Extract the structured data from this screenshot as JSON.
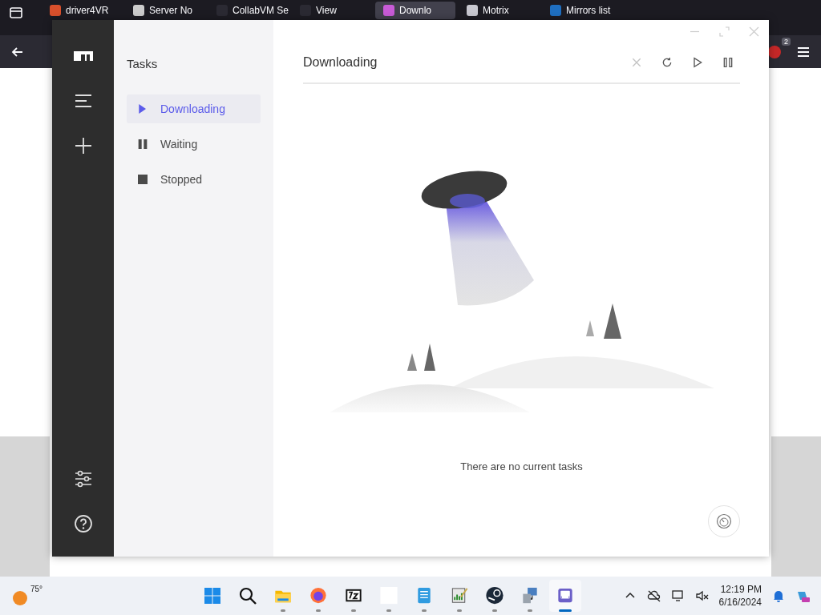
{
  "browser": {
    "tabs": [
      {
        "label": "driver4VR",
        "selected": false,
        "color": "#d9502c"
      },
      {
        "label": "Server No",
        "selected": false,
        "color": "#cccccc"
      },
      {
        "label": "CollabVM Se",
        "selected": false,
        "color": "#2b2a33"
      },
      {
        "label": "View",
        "selected": false,
        "color": "#2b2a33"
      },
      {
        "label": "Downlo",
        "selected": true,
        "color": "#c75bd6"
      },
      {
        "label": "Motrix",
        "selected": false,
        "color": "#c8c8d0"
      },
      {
        "label": "Mirrors list",
        "selected": false,
        "color": "#1f6fc0"
      }
    ],
    "badge": "2"
  },
  "app": {
    "task_list": {
      "title": "Tasks",
      "items": [
        {
          "label": "Downloading",
          "kind": "play",
          "selected": true
        },
        {
          "label": "Waiting",
          "kind": "pause",
          "selected": false
        },
        {
          "label": "Stopped",
          "kind": "stop",
          "selected": false
        }
      ]
    },
    "main": {
      "title": "Downloading",
      "toolbar": [
        {
          "kind": "delete",
          "disabled": true
        },
        {
          "kind": "refresh",
          "disabled": false
        },
        {
          "kind": "resume",
          "disabled": false
        },
        {
          "kind": "pause",
          "disabled": false
        }
      ],
      "empty_message": "There are no current tasks"
    }
  },
  "taskbar": {
    "weather": "75°",
    "apps": [
      {
        "kind": "explorer",
        "active": false
      },
      {
        "kind": "firefox",
        "active": false
      },
      {
        "kind": "archive",
        "active": false
      },
      {
        "kind": "blank",
        "active": false
      },
      {
        "kind": "notepad",
        "active": false
      },
      {
        "kind": "chart",
        "active": false
      },
      {
        "kind": "steam",
        "active": false
      },
      {
        "kind": "network",
        "active": false
      },
      {
        "kind": "motrix",
        "active": true
      }
    ],
    "time": "12:19 PM",
    "date": "6/16/2024"
  }
}
